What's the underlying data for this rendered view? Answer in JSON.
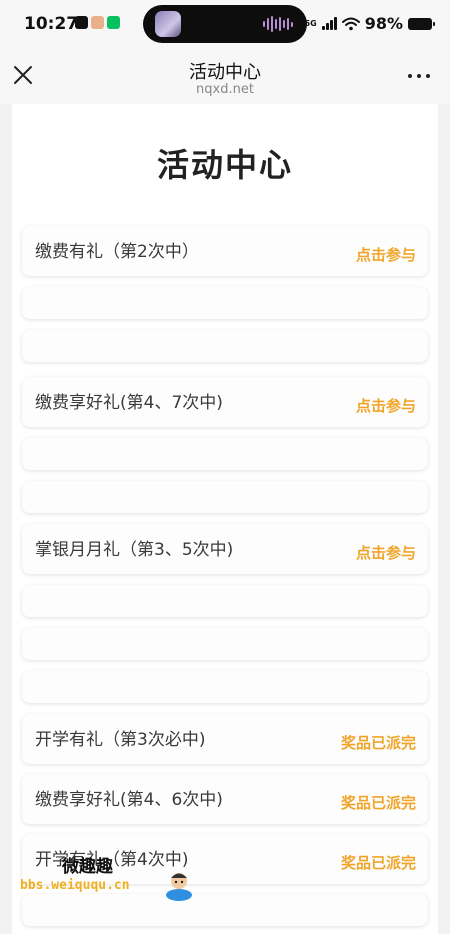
{
  "status_bar": {
    "time": "10:27",
    "signal_label": "5G",
    "battery_percent": "98%",
    "battery_level": 0.98
  },
  "nav": {
    "title": "活动中心",
    "domain": "nqxd.net"
  },
  "page": {
    "title": "活动中心"
  },
  "activities": [
    {
      "label": "缴费有礼（第2次中）",
      "action": "点击参与"
    },
    {
      "label": "",
      "action": ""
    },
    {
      "label": "",
      "action": ""
    },
    {
      "label": "缴费享好礼(第4、7次中)",
      "action": "点击参与"
    },
    {
      "label": "",
      "action": ""
    },
    {
      "label": "",
      "action": ""
    },
    {
      "label": "掌银月月礼（第3、5次中)",
      "action": "点击参与"
    },
    {
      "label": "",
      "action": ""
    },
    {
      "label": "",
      "action": ""
    },
    {
      "label": "",
      "action": ""
    },
    {
      "label": "开学有礼（第3次必中)",
      "action": "奖品已派完"
    },
    {
      "label": "缴费享好礼(第4、6次中)",
      "action": "奖品已派完"
    },
    {
      "label": "开学有礼（第4次中)",
      "action": "奖品已派完"
    },
    {
      "label": "",
      "action": ""
    }
  ],
  "watermark": {
    "title": "微趣趣",
    "site": "bbs.weiququ.cn"
  },
  "colors": {
    "accent": "#f0a52a",
    "background": "#f2f2f4",
    "card": "#fdfdfd"
  }
}
